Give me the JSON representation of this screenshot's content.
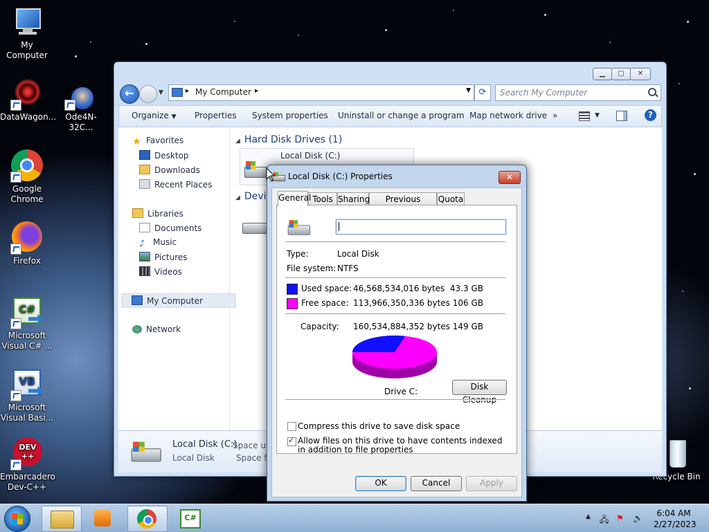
{
  "desktop": {
    "icons": [
      {
        "label": "My Computer"
      },
      {
        "label": "DataWagon..."
      },
      {
        "label": "Ode4N-32C..."
      },
      {
        "label": "Google\nChrome"
      },
      {
        "label": "Firefox"
      },
      {
        "label": "Microsoft\nVisual C# ..."
      },
      {
        "label": "Microsoft\nVisual Basi..."
      },
      {
        "label": "Embarcadero\nDev-C++"
      },
      {
        "label": "Recycle Bin"
      }
    ],
    "csharp_badge": "C#",
    "vb_badge": "VB",
    "devcpp_badge": "DEV\n++"
  },
  "explorer": {
    "address_path": "My Computer",
    "search_placeholder": "Search My Computer",
    "commands": {
      "organize": "Organize",
      "properties": "Properties",
      "system_properties": "System properties",
      "uninstall": "Uninstall or change a program",
      "map_drive": "Map network drive",
      "more": "»"
    },
    "nav": {
      "favorites": "Favorites",
      "desktop": "Desktop",
      "downloads": "Downloads",
      "recent_places": "Recent Places",
      "libraries": "Libraries",
      "documents": "Documents",
      "music": "Music",
      "pictures": "Pictures",
      "videos": "Videos",
      "my_computer": "My Computer",
      "network": "Network"
    },
    "groups": {
      "hard_disk_drives": "Hard Disk Drives (1)",
      "devices": "Devi"
    },
    "drive_tile_label": "Local Disk (C:)",
    "details": {
      "name": "Local Disk (C:)",
      "type": "Local Disk",
      "space_used": "Space use",
      "space_free": "Space fr"
    }
  },
  "dialog": {
    "title": "Local Disk (C:) Properties",
    "close_glyph": "✕",
    "tabs": [
      "General",
      "Tools",
      "Sharing",
      "Previous Versions",
      "Quota"
    ],
    "name_value": "",
    "type_label": "Type:",
    "type_value": "Local Disk",
    "fs_label": "File system:",
    "fs_value": "NTFS",
    "used_label": "Used space:",
    "used_bytes": "46,568,534,016 bytes",
    "used_gb": "43.3 GB",
    "free_label": "Free space:",
    "free_bytes": "113,966,350,336 bytes",
    "free_gb": "106 GB",
    "capacity_label": "Capacity:",
    "capacity_bytes": "160,534,884,352 bytes",
    "capacity_gb": "149 GB",
    "drive_label": "Drive C:",
    "disk_cleanup": "Disk Cleanup",
    "compress_label": "Compress this drive to save disk space",
    "compress_checked": false,
    "index_label": "Allow files on this drive to have contents indexed in addition to file properties",
    "index_checked": true,
    "ok": "OK",
    "cancel": "Cancel",
    "apply": "Apply",
    "colors": {
      "used": "#1010ff",
      "free": "#ff00ff"
    },
    "used_fraction": 0.29
  },
  "taskbar": {
    "time": "6:04 AM",
    "date": "2/27/2023"
  }
}
